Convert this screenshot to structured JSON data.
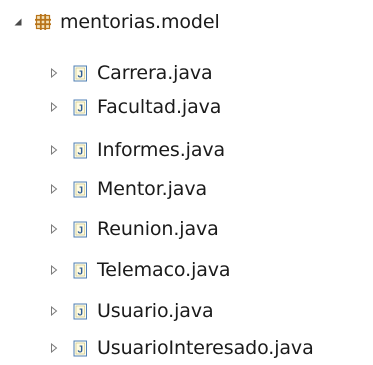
{
  "tree": {
    "package": {
      "label": "mentorias.model",
      "icon": "package-icon",
      "expanded": true
    },
    "files": [
      {
        "label": "Carrera.java",
        "icon": "java-file-icon"
      },
      {
        "label": "Facultad.java",
        "icon": "java-file-icon"
      },
      {
        "label": "Informes.java",
        "icon": "java-file-icon"
      },
      {
        "label": "Mentor.java",
        "icon": "java-file-icon"
      },
      {
        "label": "Reunion.java",
        "icon": "java-file-icon"
      },
      {
        "label": "Telemaco.java",
        "icon": "java-file-icon"
      },
      {
        "label": "Usuario.java",
        "icon": "java-file-icon"
      },
      {
        "label": "UsuarioInteresado.java",
        "icon": "java-file-icon"
      }
    ]
  },
  "colors": {
    "package_icon": "#b8741a",
    "java_icon_border": "#4f7fb4",
    "java_icon_fill": "#fdfdf0",
    "java_icon_letter": "#2f5d96",
    "twisty": "#6f6f6f"
  }
}
